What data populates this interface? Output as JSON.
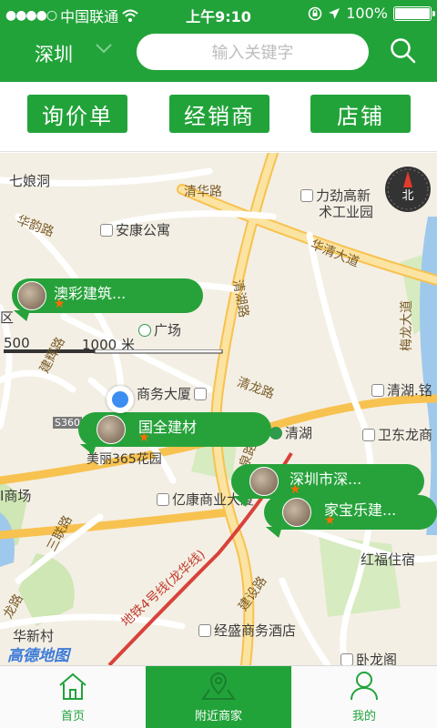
{
  "status_bar": {
    "signal_dots": "●●●●○",
    "carrier": "中国联通",
    "time": "上午9:10",
    "battery": "100%",
    "icons": [
      "wifi-icon",
      "orientation-lock-icon",
      "location-arrow-icon",
      "battery-icon"
    ]
  },
  "header": {
    "city": "深圳",
    "search_placeholder": "输入关键字",
    "icons": [
      "chevron-down-icon",
      "search-icon"
    ]
  },
  "categories": [
    "询价单",
    "经销商",
    "店铺"
  ],
  "map": {
    "scale_labels": [
      "500",
      "1000 米"
    ],
    "compass_label": "北",
    "logo_text": "高德地图",
    "place_labels": [
      "七娘洞",
      "安康公寓",
      "力劲高新",
      "术工业园",
      "广场",
      "商务大厦",
      "美丽365花园",
      "清湖",
      "卫东龙商",
      "清湖.铭",
      "亿康商业大厦",
      "红福住宿",
      "经盛商务酒店",
      "华新村",
      "卧龙阁",
      "I商场",
      "区"
    ],
    "road_labels": [
      "清华路",
      "华韵路",
      "华清大道",
      "清湖路",
      "梅龙大道",
      "建辉路",
      "清龙路",
      "三联路",
      "建设路",
      "龙路",
      "泉路",
      "地铁4号线(龙华线)",
      "S360"
    ],
    "merchants": [
      {
        "name": "澳彩建筑...",
        "rating": "★"
      },
      {
        "name": "国全建材",
        "rating": "★"
      },
      {
        "name": "深圳市深...",
        "rating": "★"
      },
      {
        "name": "家宝乐建...",
        "rating": "★"
      }
    ]
  },
  "tabs": [
    {
      "label": "首页",
      "icon": "home-icon",
      "active": false
    },
    {
      "label": "附近商家",
      "icon": "map-pin-icon",
      "active": true
    },
    {
      "label": "我的",
      "icon": "user-icon",
      "active": false
    }
  ],
  "colors": {
    "brand_green": "#22a33a",
    "accent_orange": "#ff6a00",
    "location_blue": "#3b8df0"
  }
}
